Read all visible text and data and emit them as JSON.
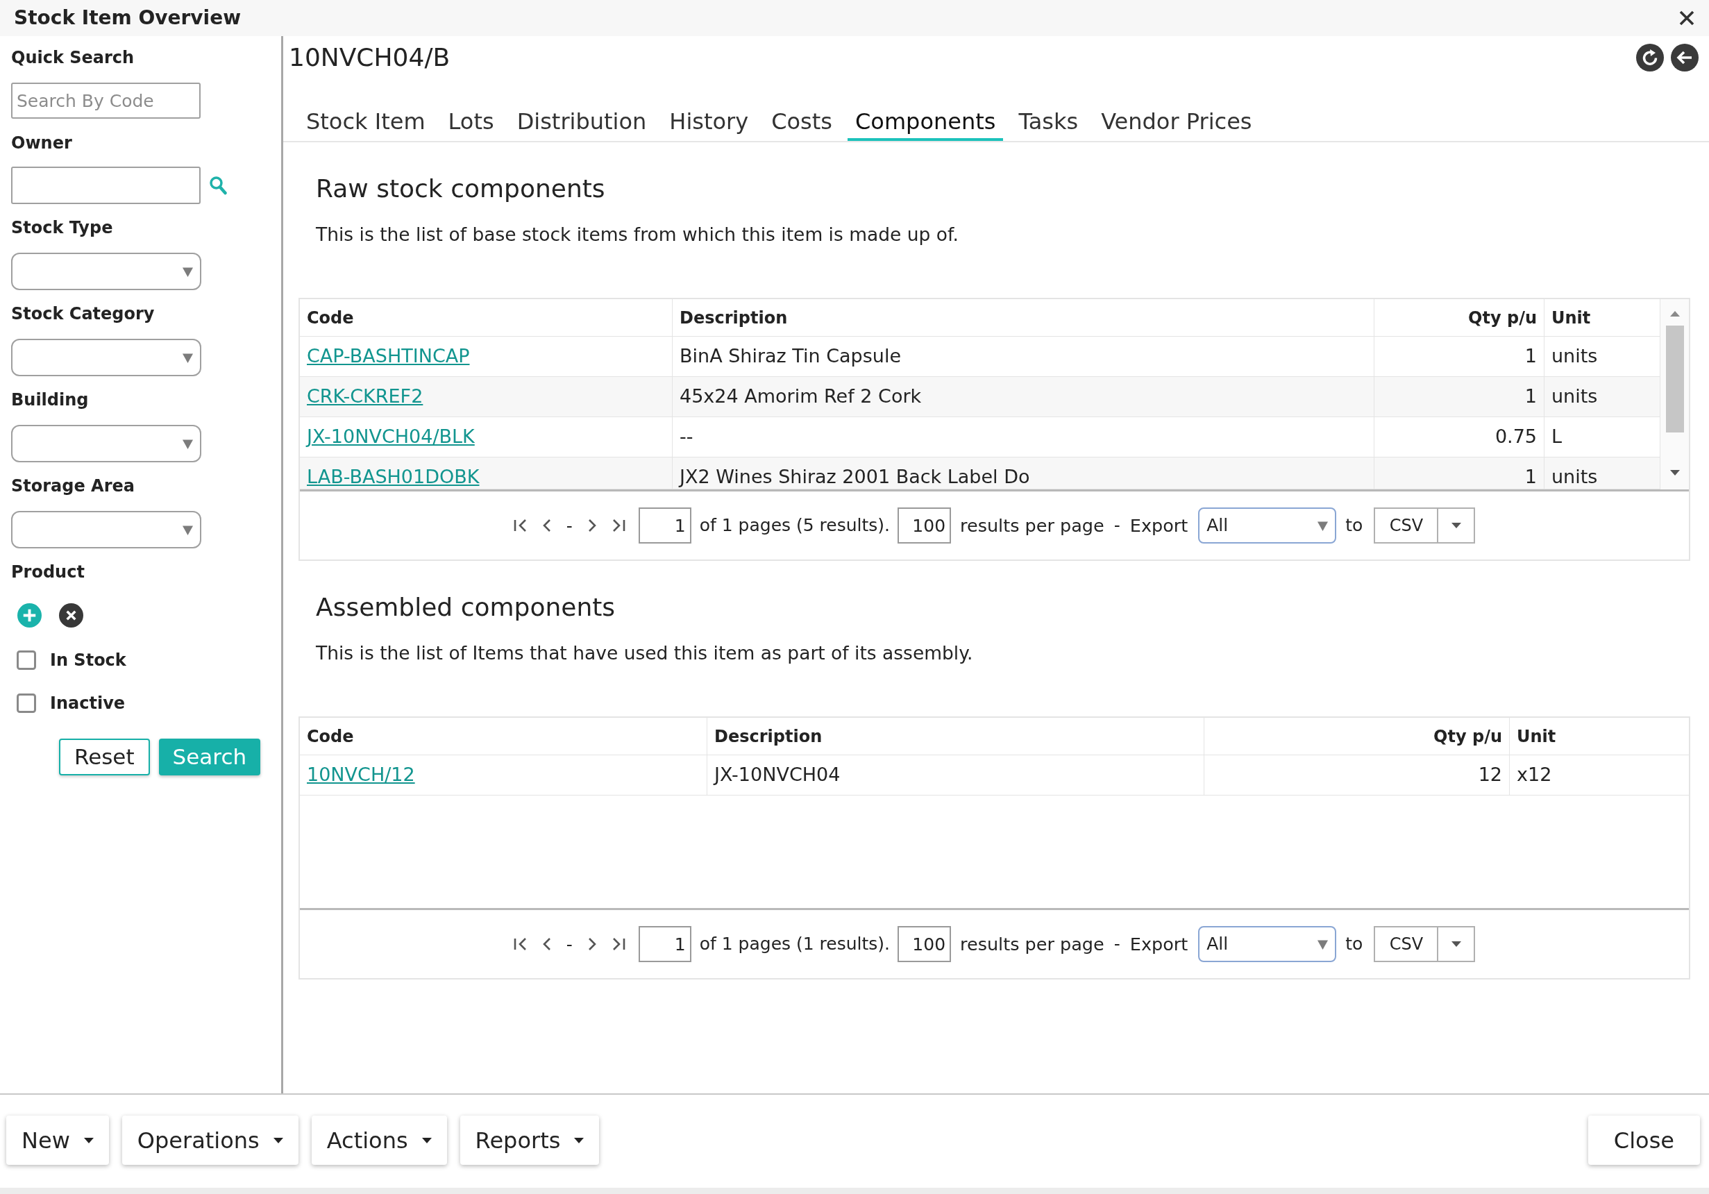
{
  "window": {
    "title": "Stock Item Overview"
  },
  "sidebar": {
    "quick_search": {
      "label": "Quick Search",
      "placeholder": "Search By Code"
    },
    "owner": {
      "label": "Owner"
    },
    "filters": [
      {
        "label": "Stock Type"
      },
      {
        "label": "Stock Category"
      },
      {
        "label": "Building"
      },
      {
        "label": "Storage Area"
      }
    ],
    "product": {
      "label": "Product"
    },
    "checkboxes": [
      {
        "label": "In Stock",
        "checked": false
      },
      {
        "label": "Inactive",
        "checked": false
      }
    ],
    "buttons": [
      {
        "label": "Reset",
        "kind": "secondary"
      },
      {
        "label": "Search",
        "kind": "primary"
      }
    ]
  },
  "record": {
    "title": "10NVCH04/B"
  },
  "tabs": [
    {
      "label": "Stock Item",
      "selected": false
    },
    {
      "label": "Lots",
      "selected": false
    },
    {
      "label": "Distribution",
      "selected": false
    },
    {
      "label": "History",
      "selected": false
    },
    {
      "label": "Costs",
      "selected": false
    },
    {
      "label": "Components",
      "selected": true
    },
    {
      "label": "Tasks",
      "selected": false
    },
    {
      "label": "Vendor Prices",
      "selected": false
    }
  ],
  "sections": [
    {
      "title": "Raw stock components",
      "description": "This is the list of base stock items from which this item is made up of.",
      "table": {
        "scrollable": true,
        "columns": [
          {
            "label": "Code",
            "kind": "link"
          },
          {
            "label": "Description",
            "kind": "text"
          },
          {
            "label": "Qty p/u",
            "kind": "number"
          },
          {
            "label": "Unit",
            "kind": "text"
          }
        ],
        "rows": [
          {
            "cells": [
              "CAP-BASHTINCAP",
              "BinA Shiraz Tin Capsule",
              "1",
              "units"
            ]
          },
          {
            "cells": [
              "CRK-CKREF2",
              "45x24 Amorim Ref 2 Cork",
              "1",
              "units"
            ]
          },
          {
            "cells": [
              "JX-10NVCH04/BLK",
              "--",
              "0.75",
              "L"
            ]
          },
          {
            "cells": [
              "LAB-BASH01DOBK",
              "JX2 Wines Shiraz 2001 Back Label Do",
              "1",
              "units"
            ]
          }
        ]
      },
      "pagination": {
        "separator": "-",
        "page": "1",
        "summary": "of 1 pages (5 results).",
        "page_size": "100",
        "per_page_label": "results per page",
        "dash": "-",
        "export_label": "Export",
        "export_scope": "All",
        "to_label": "to",
        "format": "CSV"
      }
    },
    {
      "title": "Assembled components",
      "description": "This is the list of Items that have used this item as part of its assembly.",
      "table": {
        "scrollable": false,
        "columns": [
          {
            "label": "Code",
            "kind": "link"
          },
          {
            "label": "Description",
            "kind": "text"
          },
          {
            "label": "Qty p/u",
            "kind": "number"
          },
          {
            "label": "Unit",
            "kind": "text"
          }
        ],
        "rows": [
          {
            "cells": [
              "10NVCH/12",
              "JX-10NVCH04",
              "12",
              "x12"
            ]
          }
        ]
      },
      "pagination": {
        "separator": "-",
        "page": "1",
        "summary": "of 1 pages (1 results).",
        "page_size": "100",
        "per_page_label": "results per page",
        "dash": "-",
        "export_label": "Export",
        "export_scope": "All",
        "to_label": "to",
        "format": "CSV"
      }
    }
  ],
  "footer": {
    "menus": [
      {
        "label": "New"
      },
      {
        "label": "Operations"
      },
      {
        "label": "Actions"
      },
      {
        "label": "Reports"
      }
    ],
    "close": {
      "label": "Close"
    }
  }
}
